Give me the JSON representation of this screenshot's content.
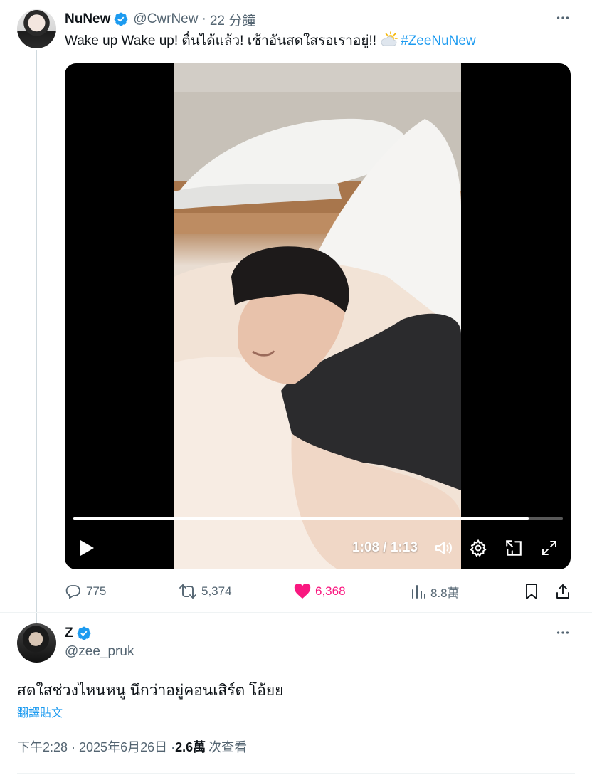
{
  "tweet": {
    "author_name": "NuNew",
    "author_handle": "@CwrNew",
    "separator": "·",
    "time_ago": "22 分鐘",
    "text_main": "Wake up Wake up! ตื่นได้แล้ว! เช้าอันสดใสรอเราอยู่!!",
    "hashtag": "#ZeeNuNew",
    "more_icon": "more-horizontal-icon"
  },
  "video": {
    "time_display": "1:08 / 1:13",
    "progress": 0.93,
    "controls": [
      "play-icon",
      "volume-icon",
      "settings-icon",
      "picture-in-picture-icon",
      "fullscreen-icon"
    ]
  },
  "actions": {
    "replies": "775",
    "reposts": "5,374",
    "likes": "6,368",
    "views": "8.8萬"
  },
  "reply": {
    "author_name": "Z",
    "author_handle": "@zee_pruk",
    "text": "สดใสช่วงไหนหนู นึกว่าอยู่คอนเสิร์ต โอ้ยย",
    "translate_label": "翻譯貼文",
    "timestamp": "下午2:28 · 2025年6月26日 · ",
    "views_count": "2.6萬",
    "views_label": "次查看"
  },
  "colors": {
    "accent": "#1d9bf0",
    "like": "#f91880",
    "secondary_text": "#536471"
  }
}
